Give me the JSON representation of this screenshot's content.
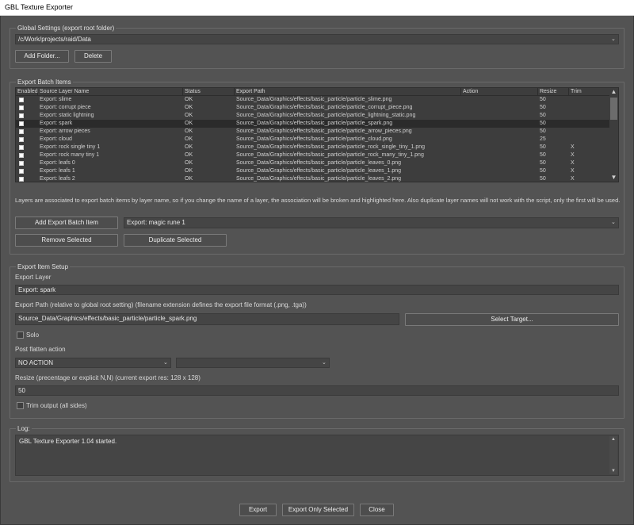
{
  "window": {
    "title": "GBL Texture Exporter"
  },
  "global_settings": {
    "title": "Global Settings (export root folder)",
    "root_folder": "/c/Work/projects/raid/Data",
    "add_folder_label": "Add Folder...",
    "delete_label": "Delete"
  },
  "export_batch": {
    "title": "Export Batch Items",
    "columns": [
      "Enabled",
      "Source Layer Name",
      "Status",
      "Export Path",
      "Action",
      "Resize",
      "Trim"
    ],
    "rows": [
      {
        "layer": "Export: slime",
        "status": "OK",
        "path": "Source_Data/Graphics/effects/basic_particle/particle_slime.png",
        "action": "",
        "resize": "50",
        "trim": ""
      },
      {
        "layer": "Export: corrupt piece",
        "status": "OK",
        "path": "Source_Data/Graphics/effects/basic_particle/particle_corrupt_piece.png",
        "action": "",
        "resize": "50",
        "trim": ""
      },
      {
        "layer": "Export: static lightning",
        "status": "OK",
        "path": "Source_Data/Graphics/effects/basic_particle/particle_lightning_static.png",
        "action": "",
        "resize": "50",
        "trim": ""
      },
      {
        "layer": "Export: spark",
        "status": "OK",
        "path": "Source_Data/Graphics/effects/basic_particle/particle_spark.png",
        "action": "",
        "resize": "50",
        "trim": ""
      },
      {
        "layer": "Export: arrow pieces",
        "status": "OK",
        "path": "Source_Data/Graphics/effects/basic_particle/particle_arrow_pieces.png",
        "action": "",
        "resize": "50",
        "trim": ""
      },
      {
        "layer": "Export: cloud",
        "status": "OK",
        "path": "Source_Data/Graphics/effects/basic_particle/particle_cloud.png",
        "action": "",
        "resize": "25",
        "trim": ""
      },
      {
        "layer": "Export: rock single tiny 1",
        "status": "OK",
        "path": "Source_Data/Graphics/effects/basic_particle/particle_rock_single_tiny_1.png",
        "action": "",
        "resize": "50",
        "trim": "X"
      },
      {
        "layer": "Export: rock many tiny 1",
        "status": "OK",
        "path": "Source_Data/Graphics/effects/basic_particle/particle_rock_many_tiny_1.png",
        "action": "",
        "resize": "50",
        "trim": "X"
      },
      {
        "layer": "Export: leafs 0",
        "status": "OK",
        "path": "Source_Data/Graphics/effects/basic_particle/particle_leaves_0.png",
        "action": "",
        "resize": "50",
        "trim": "X"
      },
      {
        "layer": "Export: leafs 1",
        "status": "OK",
        "path": "Source_Data/Graphics/effects/basic_particle/particle_leaves_1.png",
        "action": "",
        "resize": "50",
        "trim": "X"
      },
      {
        "layer": "Export: leafs 2",
        "status": "OK",
        "path": "Source_Data/Graphics/effects/basic_particle/particle_leaves_2.png",
        "action": "",
        "resize": "50",
        "trim": "X"
      }
    ],
    "selected_row": 3,
    "info_text": "Layers are associated to export batch items by layer name, so if you change the name of a layer, the association will be broken and highlighted here. Also duplicate layer names will not work with the script, only the first will be used.",
    "add_label": "Add Export Batch Item",
    "layer_select_value": "Export: magic rune 1",
    "remove_label": "Remove Selected",
    "duplicate_label": "Duplicate Selected"
  },
  "export_item_setup": {
    "title": "Export Item Setup",
    "export_layer_label": "Export Layer",
    "export_layer_value": "Export: spark",
    "export_path_label": "Export Path (relative to global root setting) (filename extension defines the export file format (.png, .tga))",
    "export_path_value": "Source_Data/Graphics/effects/basic_particle/particle_spark.png",
    "select_target_label": "Select Target...",
    "solo_label": "Solo",
    "post_flatten_label": "Post flatten action",
    "post_flatten_value": "NO ACTION",
    "post_flatten_secondary": "",
    "resize_label": "Resize (precentage or explicit N,N) (current export res: 128 x 128)",
    "resize_value": "50",
    "trim_label": "Trim output (all sides)"
  },
  "log": {
    "title": "Log:",
    "text": "GBL Texture Exporter 1.04 started."
  },
  "footer": {
    "export_label": "Export",
    "export_selected_label": "Export Only Selected",
    "close_label": "Close"
  }
}
